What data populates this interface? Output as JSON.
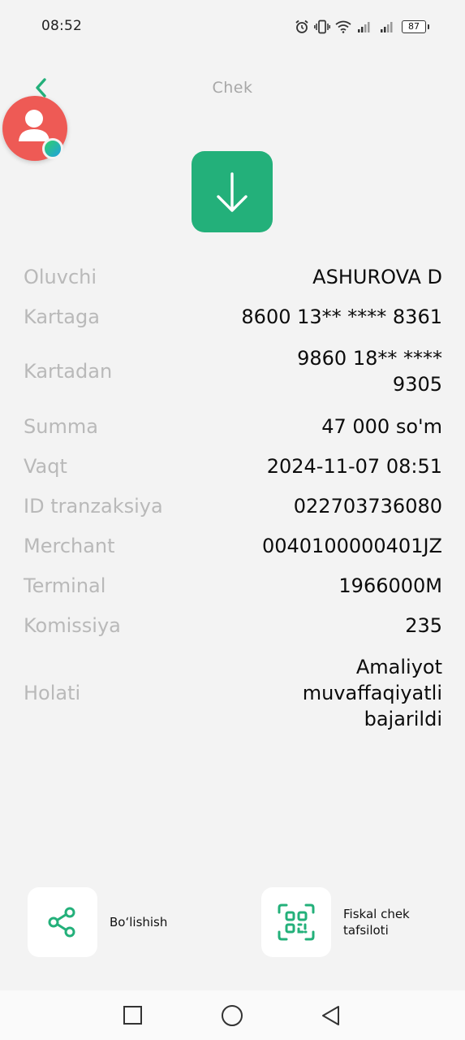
{
  "status_bar": {
    "time": "08:52",
    "battery": "87",
    "icons": [
      "alarm-icon",
      "vibrate-icon",
      "wifi-icon",
      "signal-icon",
      "signal-icon",
      "battery-icon"
    ]
  },
  "header": {
    "title": "Chek",
    "back_icon": "chevron-left-icon"
  },
  "details": {
    "recipient": {
      "label": "Oluvchi",
      "value": "ASHUROVA D"
    },
    "to_card": {
      "label": "Kartaga",
      "value": "8600 13** **** 8361"
    },
    "from_card": {
      "label": "Kartadan",
      "value": "9860 18** **** 9305"
    },
    "amount": {
      "label": "Summa",
      "value": "47 000 so'm"
    },
    "time": {
      "label": "Vaqt",
      "value": "2024-11-07 08:51"
    },
    "transaction_id": {
      "label": "ID tranzaksiya",
      "value": "022703736080"
    },
    "merchant": {
      "label": "Merchant",
      "value": "004010000040​1JZ"
    },
    "terminal": {
      "label": "Terminal",
      "value": "1966000M"
    },
    "commission": {
      "label": "Komissiya",
      "value": "235"
    },
    "status": {
      "label": "Holati",
      "value": "Amaliyot muvaffaqiyatli bajarildi"
    }
  },
  "actions": {
    "share_label": "Boʻlishish",
    "fiscal_label": "Fiskal chek tafsiloti"
  },
  "colors": {
    "accent": "#23b07a",
    "label_gray": "#b9b9b9",
    "avatar": "#ee5a55"
  }
}
